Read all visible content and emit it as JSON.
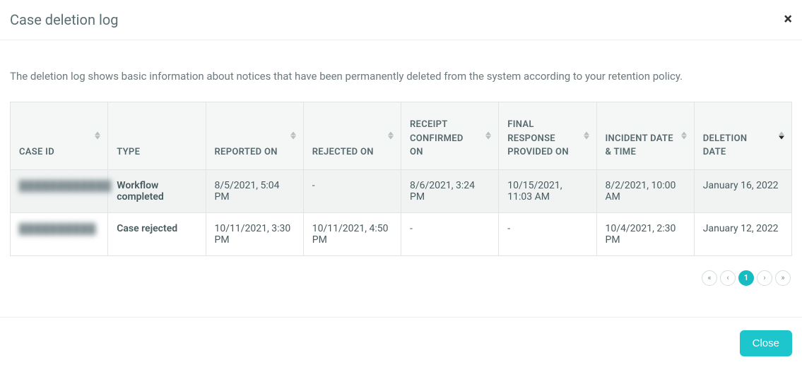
{
  "modal": {
    "title": "Case deletion log",
    "close_x": "×"
  },
  "intro": "The deletion log shows basic information about notices that have been permanently deleted from the system according to your retention policy.",
  "columns": {
    "case_id": "CASE ID",
    "type": "TYPE",
    "reported_on": "REPORTED ON",
    "rejected_on": "REJECTED ON",
    "receipt_confirmed_on": "RECEIPT CONFIRMED ON",
    "final_response_on": "FINAL RESPONSE PROVIDED ON",
    "incident_datetime": "INCIDENT DATE & TIME",
    "deletion_date": "DELETION DATE"
  },
  "rows": [
    {
      "case_id": "████████████",
      "type": "Workflow completed",
      "reported_on": "8/5/2021, 5:04 PM",
      "rejected_on": "-",
      "receipt_confirmed_on": "8/6/2021, 3:24 PM",
      "final_response_on": "10/15/2021, 11:03 AM",
      "incident_datetime": "8/2/2021, 10:00 AM",
      "deletion_date": "January 16, 2022"
    },
    {
      "case_id": "██████████",
      "type": "Case rejected",
      "reported_on": "10/11/2021, 3:30 PM",
      "rejected_on": "10/11/2021, 4:50 PM",
      "receipt_confirmed_on": "-",
      "final_response_on": "-",
      "incident_datetime": "10/4/2021, 2:30 PM",
      "deletion_date": "January 12, 2022"
    }
  ],
  "pagination": {
    "first": "«",
    "prev": "‹",
    "page1": "1",
    "next": "›",
    "last": "»"
  },
  "footer": {
    "close_label": "Close"
  }
}
